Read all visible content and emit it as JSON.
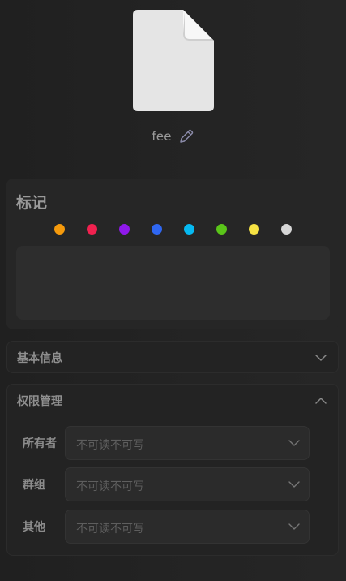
{
  "file": {
    "name": "fee",
    "icon": "document-icon",
    "edit_icon": "pencil-icon"
  },
  "tags": {
    "title": "标记",
    "colors": [
      {
        "name": "orange",
        "hex": "#f59a0c"
      },
      {
        "name": "red",
        "hex": "#f1214f"
      },
      {
        "name": "purple",
        "hex": "#8f19ea"
      },
      {
        "name": "blue",
        "hex": "#2f67f2"
      },
      {
        "name": "cyan",
        "hex": "#06b9f1"
      },
      {
        "name": "green",
        "hex": "#5ac519"
      },
      {
        "name": "yellow",
        "hex": "#f6e243"
      },
      {
        "name": "gray",
        "hex": "#d6d6d6"
      }
    ]
  },
  "basic_info": {
    "title": "基本信息",
    "expanded": false
  },
  "permissions": {
    "title": "权限管理",
    "expanded": true,
    "rows": [
      {
        "label": "所有者",
        "value": "不可读不可写"
      },
      {
        "label": "群组",
        "value": "不可读不可写"
      },
      {
        "label": "其他",
        "value": "不可读不可写"
      }
    ]
  }
}
